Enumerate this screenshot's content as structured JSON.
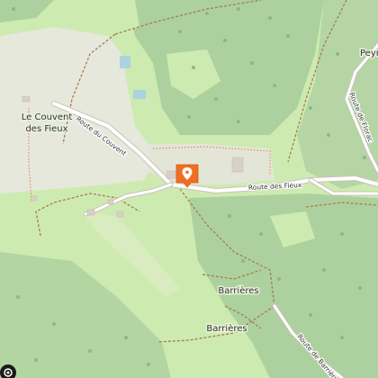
{
  "map": {
    "colors": {
      "meadow": "#cdebb0",
      "forest": "#add19e",
      "forest_dark": "#a3c996",
      "clearing": "#dcecc8",
      "settlement": "#e8e5dd",
      "road": "#ffffff",
      "road_casing": "#c9c3b8",
      "track": "#a87a4f",
      "path": "#e2745c",
      "water": "#aad3df",
      "marker": "#f06e23"
    },
    "places": {
      "couvent_line1": "Le Couvent",
      "couvent_line2": "des Fieux",
      "peyr": "Peyr",
      "barrieres_1": "Barrières",
      "barrieres_2": "Barrières"
    },
    "roads": {
      "route_du_couvent": "Route du Couvent",
      "route_des_fieux": "Route des Fieux",
      "route_de_barrieres": "Route de Barrières",
      "route_de_florac": "Route de Florac"
    },
    "marker": {
      "icon": "map-pin-icon"
    },
    "controls": {
      "icon": "locate-icon"
    }
  }
}
